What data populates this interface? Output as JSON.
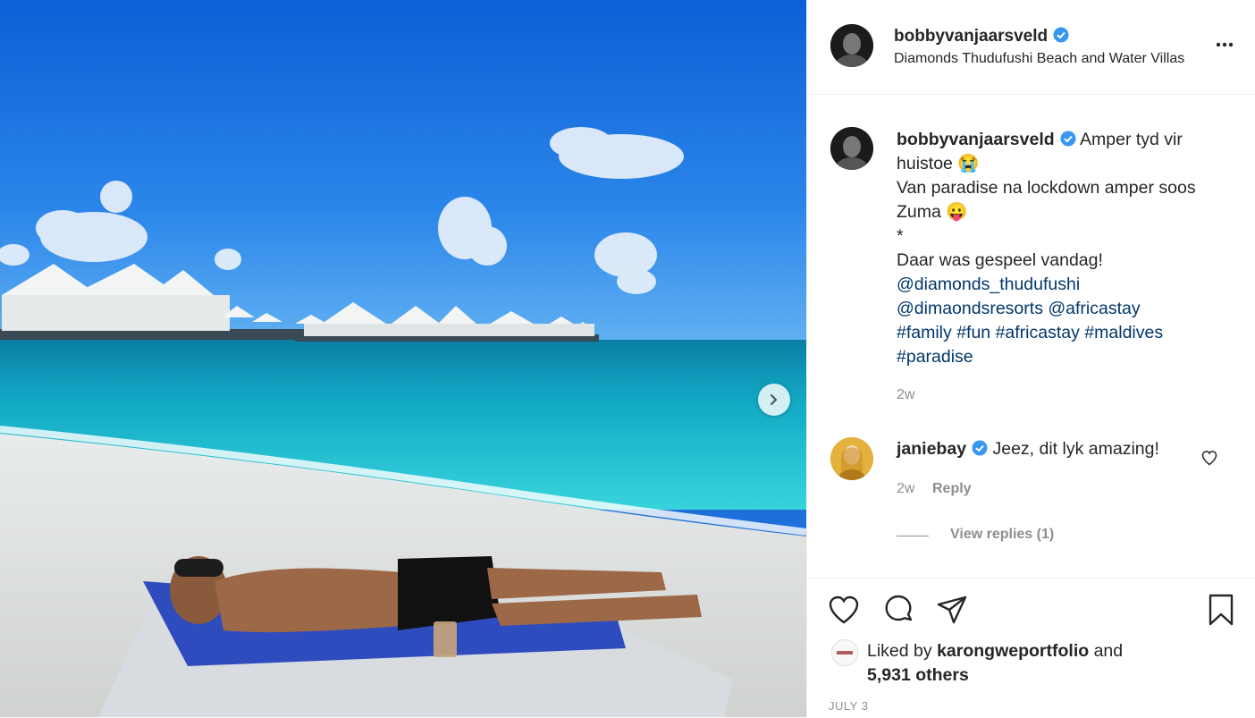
{
  "post": {
    "username": "bobbyvanjaarsveld",
    "location": "Diamonds Thudufushi Beach and Water Villas",
    "caption": {
      "line1": "Amper tyd vir",
      "line2": "huistoe",
      "emoji1": "😭",
      "line3": "Van paradise na lockdown amper soos",
      "line4": "Zuma",
      "emoji2": "😛",
      "line5": "*",
      "line6": "Daar was gespeel vandag!",
      "mentions": [
        "@diamonds_thudufushi",
        "@dimaondsresorts",
        "@africastay"
      ],
      "hashtags": [
        "#family",
        "#fun",
        "#africastay",
        "#maldives",
        "#paradise"
      ]
    },
    "caption_time": "2w",
    "comments": [
      {
        "username": "janiebay",
        "text": "Jeez, dit lyk amazing!",
        "time": "2w",
        "reply_label": "Reply",
        "view_replies": "View replies (1)"
      }
    ],
    "likes": {
      "prefix": "Liked by",
      "liker": "karongweportfolio",
      "and": "and",
      "others": "5,931 others"
    },
    "date": "JULY 3"
  },
  "icons": {
    "verified": "verified-badge-icon",
    "more": "more-options-icon",
    "next": "chevron-right-icon",
    "like": "heart-icon",
    "comment": "comment-bubble-icon",
    "share": "paper-plane-icon",
    "save": "bookmark-icon"
  },
  "colors": {
    "verified": "#3897f0",
    "link": "#00376b",
    "muted": "#8e8e8e",
    "text": "#262626"
  }
}
